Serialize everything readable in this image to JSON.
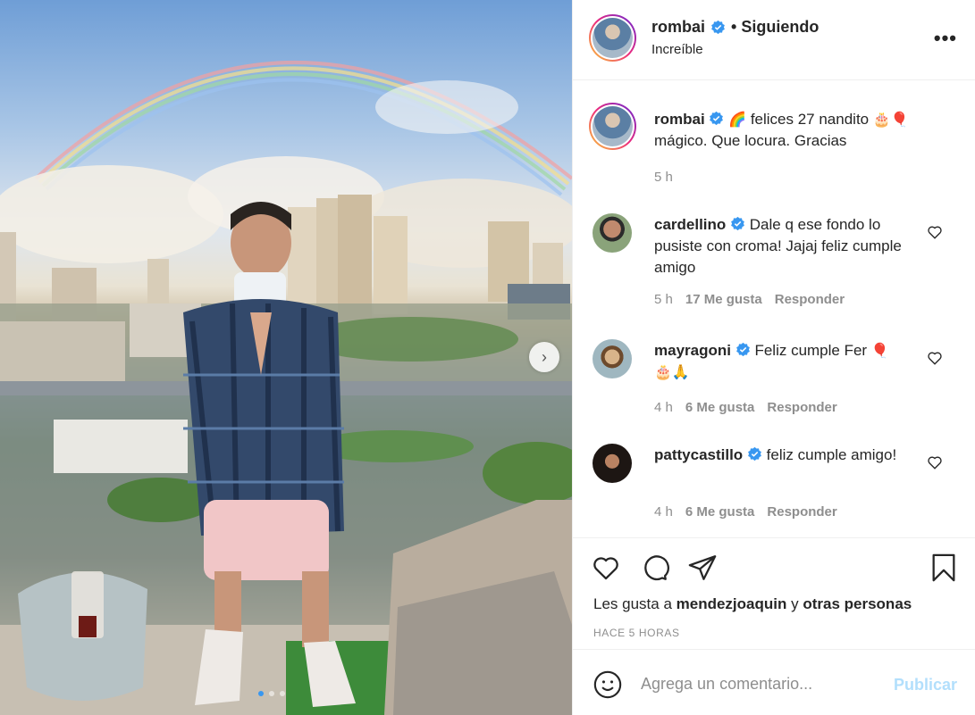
{
  "post": {
    "author": "rombai",
    "follow_status": "• Siguiendo",
    "location": "Increíble",
    "more_icon": "more-horizontal-icon",
    "carousel": {
      "current": 1,
      "total": 3
    },
    "caption": {
      "author": "rombai",
      "text_part1": "felices 27 nandito",
      "text_part2": "mágico. Que locura. Gracias",
      "emoji1": "🌈",
      "emoji2": "🎂🎈",
      "time": "5 h"
    }
  },
  "comments": [
    {
      "user": "cardellino",
      "text": "Dale q ese fondo lo pusiste con croma! Jajaj feliz cumple amigo",
      "time": "5 h",
      "likes": "17 Me gusta",
      "reply": "Responder"
    },
    {
      "user": "mayragoni",
      "text": "Feliz cumple Fer",
      "emoji": "🎈",
      "emoji_line2": "🎂🙏",
      "time": "4 h",
      "likes": "6 Me gusta",
      "reply": "Responder"
    },
    {
      "user": "pattycastillo",
      "text": "feliz cumple amigo!",
      "time": "4 h",
      "likes": "6 Me gusta",
      "reply": "Responder"
    }
  ],
  "likes": {
    "prefix": "Les gusta a",
    "user": "mendezjoaquin",
    "joiner": "y",
    "others": "otras personas"
  },
  "timestamp": "HACE 5 HORAS",
  "composer": {
    "placeholder": "Agrega un comentario...",
    "publish": "Publicar"
  },
  "colors": {
    "verified": "#3897f0",
    "publish_disabled": "#b2dffc",
    "secondary_text": "#8e8e8e"
  }
}
